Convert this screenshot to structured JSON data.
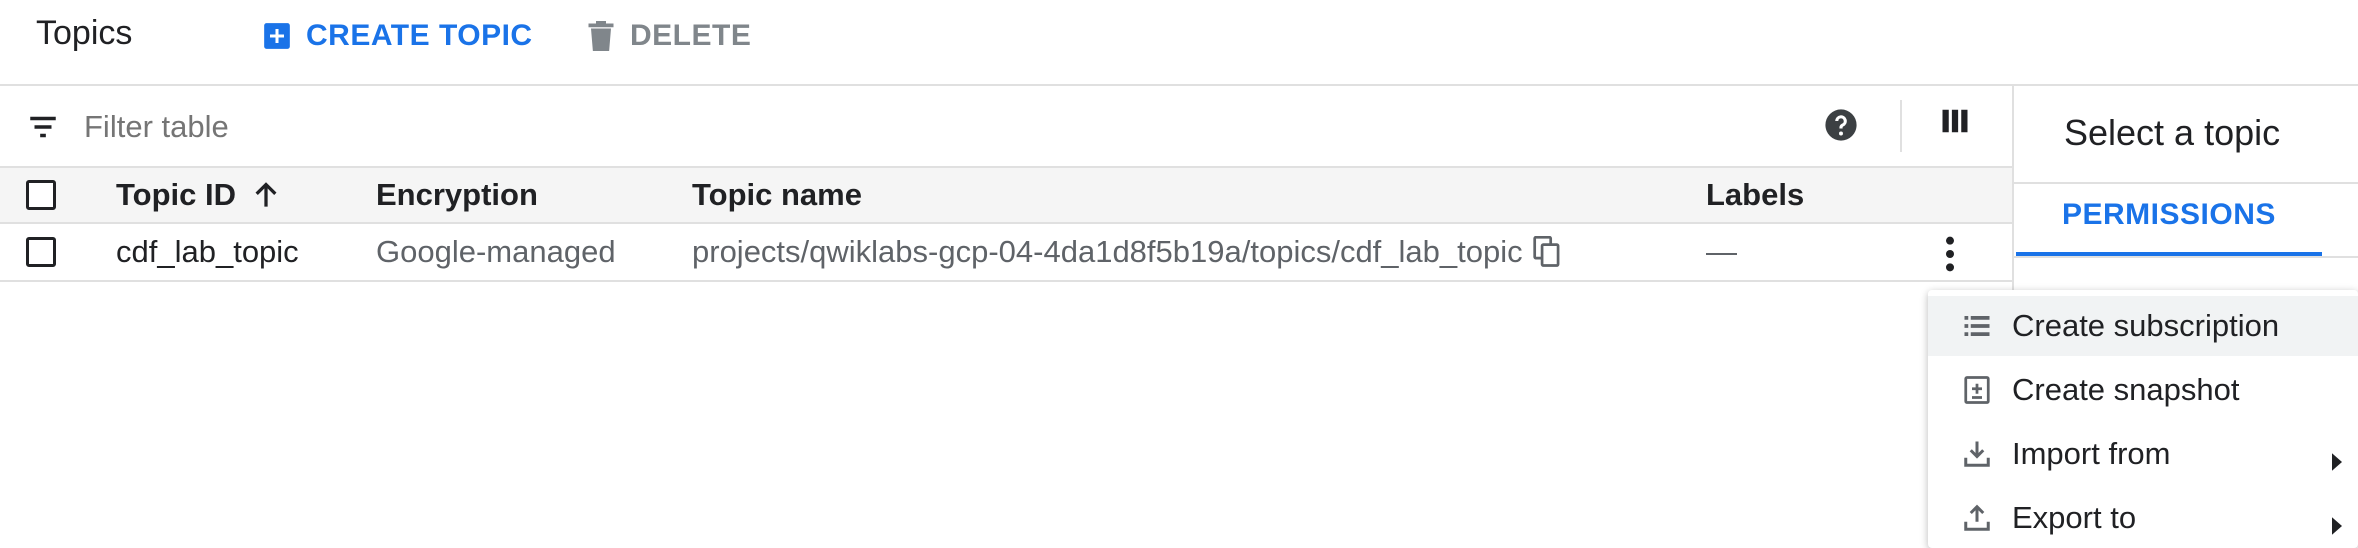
{
  "header": {
    "title": "Topics",
    "create_label": "CREATE TOPIC",
    "delete_label": "DELETE"
  },
  "filter": {
    "placeholder": "Filter table"
  },
  "table": {
    "columns": [
      "Topic ID",
      "Encryption",
      "Topic name",
      "Labels"
    ],
    "rows": [
      {
        "topic_id": "cdf_lab_topic",
        "encryption": "Google-managed",
        "topic_name": "projects/qwiklabs-gcp-04-4da1d8f5b19a/topics/cdf_lab_topic",
        "labels": "—"
      }
    ]
  },
  "right_panel": {
    "title": "Select a topic",
    "tab": "PERMISSIONS"
  },
  "menu": {
    "items": [
      {
        "label": "Create subscription",
        "icon": "list-icon"
      },
      {
        "label": "Create snapshot",
        "icon": "snapshot-icon"
      },
      {
        "label": "Import from",
        "icon": "import-icon"
      },
      {
        "label": "Export to",
        "icon": "export-icon"
      }
    ]
  },
  "colors": {
    "accent": "#1a73e8",
    "muted": "#80868b"
  }
}
